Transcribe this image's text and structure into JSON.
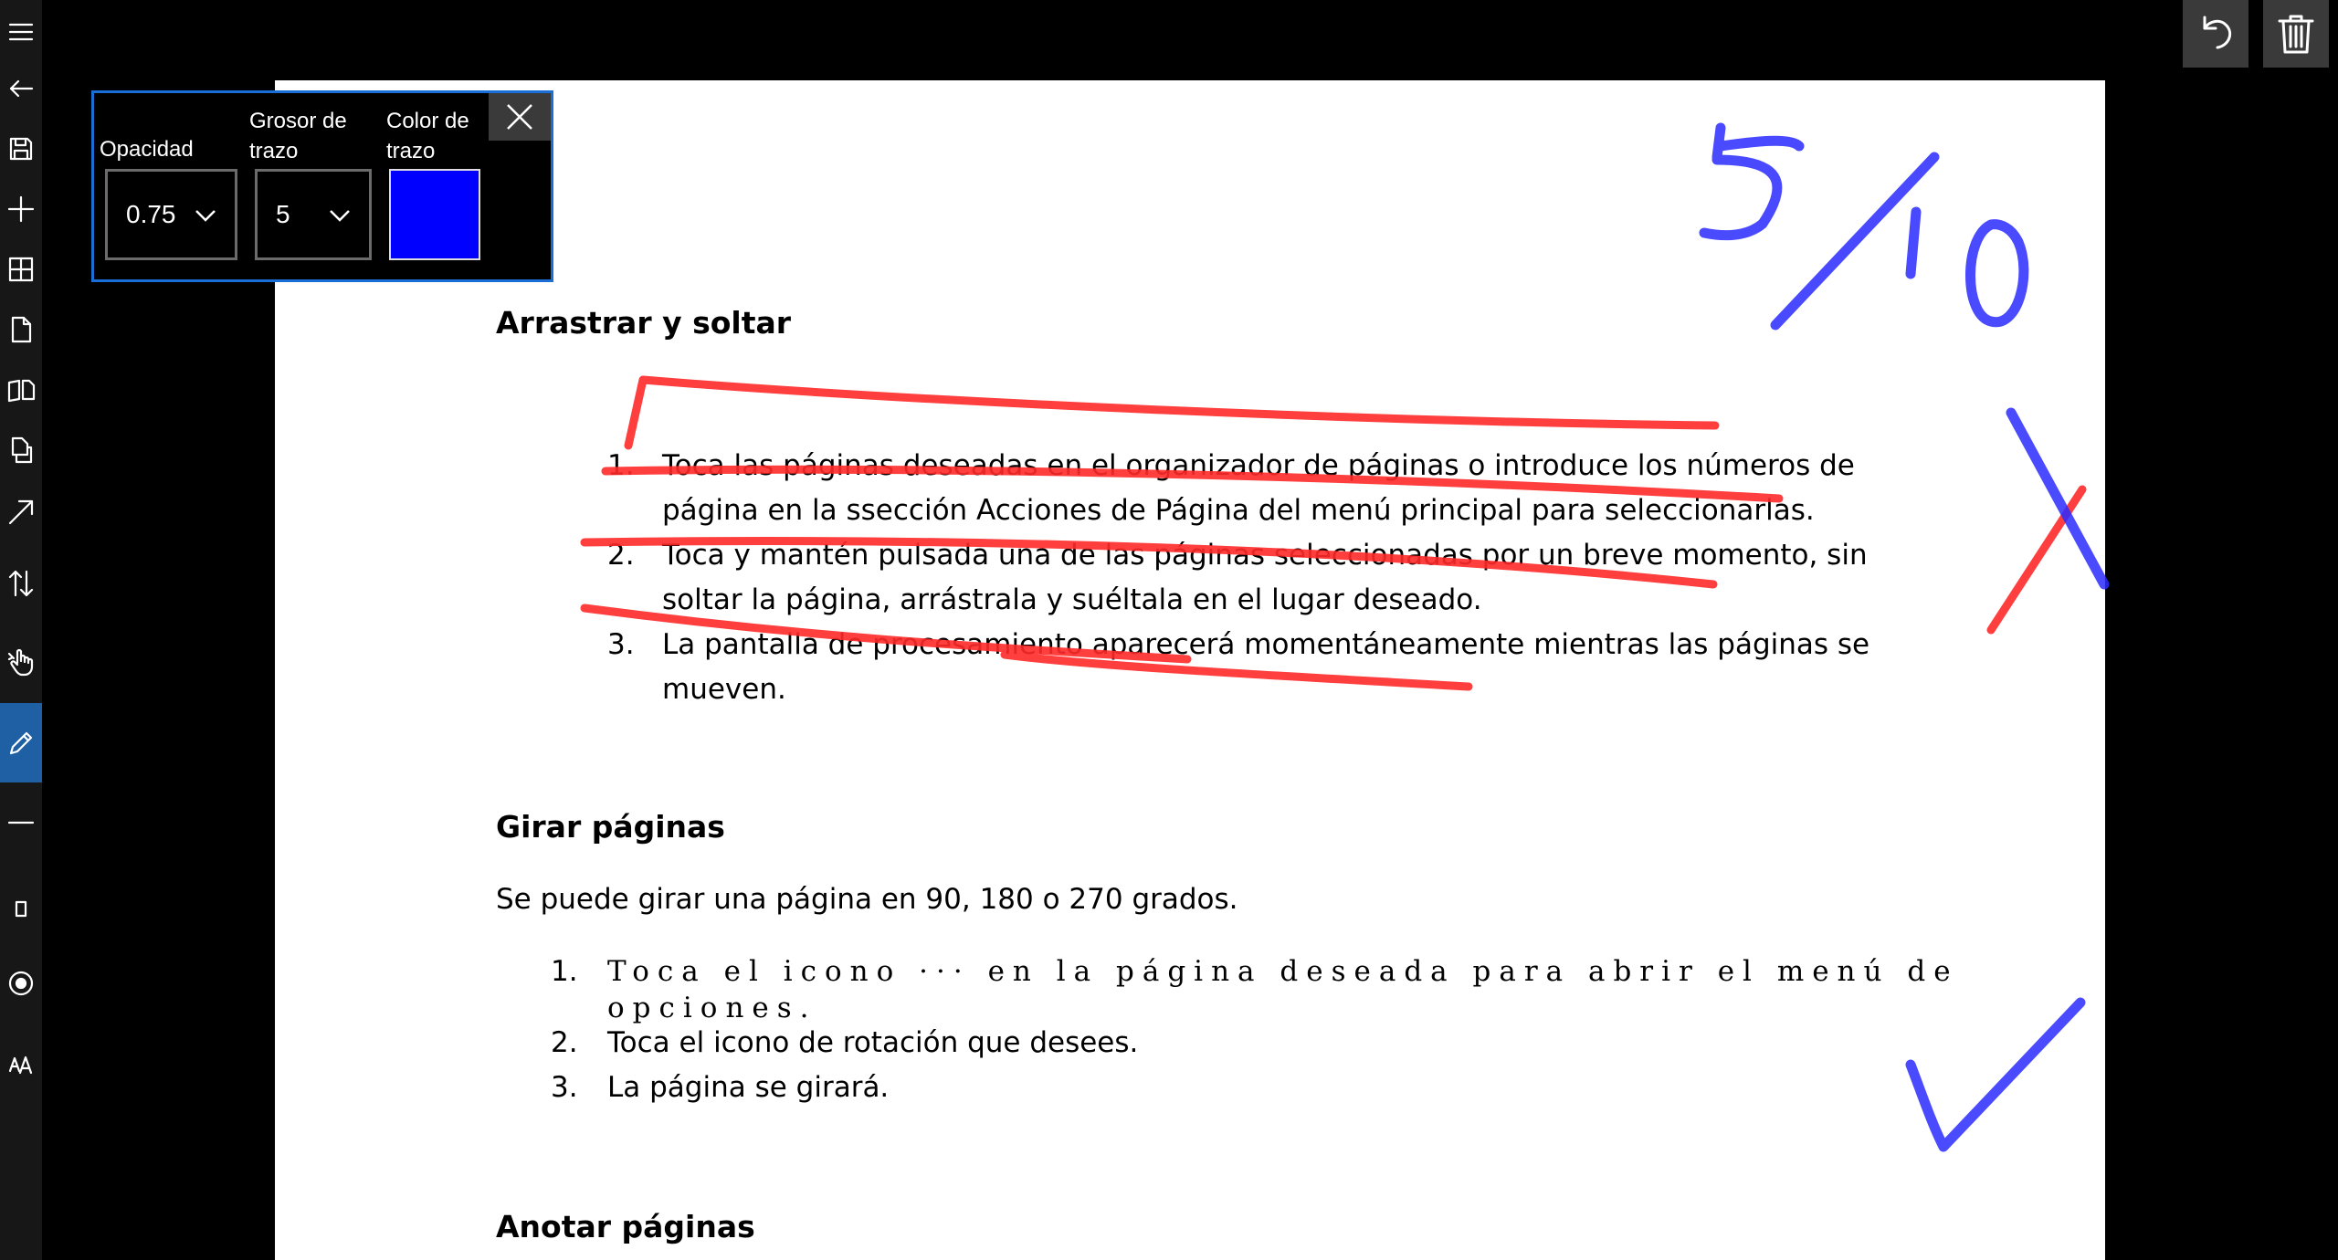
{
  "sidebar": {
    "items": [
      {
        "name": "hamburger-menu-icon",
        "label": "Menu"
      },
      {
        "name": "back-arrow-icon",
        "label": "Back"
      },
      {
        "name": "save-icon",
        "label": "Save"
      },
      {
        "name": "add-icon",
        "label": "Add"
      },
      {
        "name": "grid-view-icon",
        "label": "Page organizer"
      },
      {
        "name": "single-page-icon",
        "label": "Single page"
      },
      {
        "name": "two-page-icon",
        "label": "Two pages"
      },
      {
        "name": "copy-pages-icon",
        "label": "Copy pages"
      },
      {
        "name": "diagonal-arrow-icon",
        "label": "Fit"
      },
      {
        "name": "scroll-direction-icon",
        "label": "Scroll direction"
      },
      {
        "name": "hand-pointer-icon",
        "label": "Pan"
      },
      {
        "name": "pen-icon",
        "label": "Pen",
        "active": true
      },
      {
        "name": "minus-icon",
        "label": "Line"
      },
      {
        "name": "rectangle-icon",
        "label": "Rectangle"
      },
      {
        "name": "record-icon",
        "label": "Circle"
      },
      {
        "name": "text-size-icon",
        "label": "Text"
      }
    ]
  },
  "top_actions": {
    "undo_icon": "undo-icon",
    "delete_icon": "trash-icon"
  },
  "flyout": {
    "opacity_label": "Opacidad",
    "opacity_value": "0.75",
    "thickness_label": "Grosor de\ntrazo",
    "thickness_value": "5",
    "color_label": "Color de\ntrazo",
    "color_value": "#0000ff",
    "close_icon": "close-icon"
  },
  "document": {
    "section1": {
      "title": "Arrastrar y soltar",
      "items": [
        {
          "num": "1.",
          "lines": [
            "Toca las páginas deseadas en el organizador de páginas o introduce los números de",
            "página en la ssección Acciones de Página del menú principal para seleccionarlas."
          ]
        },
        {
          "num": "2.",
          "lines": [
            "Toca y mantén pulsada una de las páginas seleccionadas por un breve momento, sin",
            "soltar la página, arrástrala y suéltala en el lugar deseado."
          ]
        },
        {
          "num": "3.",
          "lines": [
            "La pantalla de procesamiento aparecerá momentáneamente mientras las páginas se",
            "mueven."
          ]
        }
      ]
    },
    "section2": {
      "title": "Girar páginas",
      "intro": "Se puede girar una página en 90, 180 o 270 grados.",
      "items": [
        {
          "num": "1.",
          "lines": [
            "Toca el icono ··· en la página deseada para abrir el menú de",
            "opciones."
          ]
        },
        {
          "num": "2.",
          "lines": [
            "Toca el icono de rotación que desees."
          ]
        },
        {
          "num": "3.",
          "lines": [
            "La página se girará."
          ]
        }
      ]
    },
    "section3": {
      "title": "Anotar páginas"
    }
  },
  "annotations": {
    "score_text": "5/10",
    "red_ink_color": "#ff2a2a",
    "blue_ink_color": "#2a2aff"
  }
}
